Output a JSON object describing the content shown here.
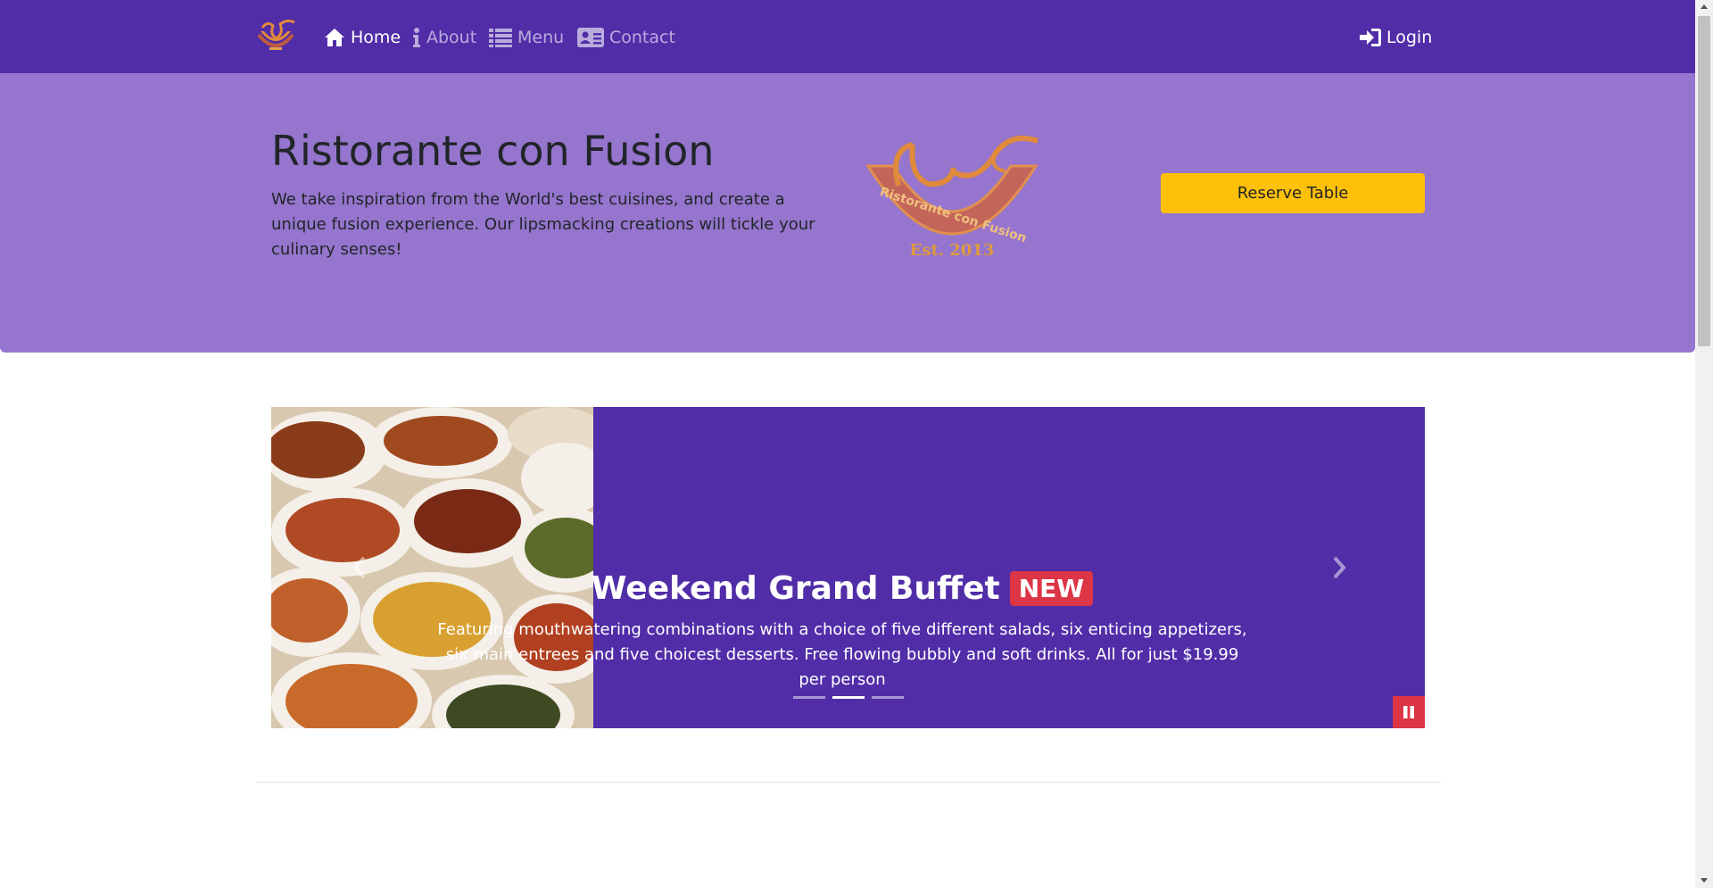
{
  "nav": {
    "home": "Home",
    "about": "About",
    "menu": "Menu",
    "contact": "Contact",
    "login": "Login",
    "icons": {
      "home": "home-icon",
      "about": "info-icon",
      "menu": "list-icon",
      "contact": "address-card-icon",
      "login": "sign-in-icon"
    }
  },
  "jumbotron": {
    "title": "Ristorante con Fusion",
    "text": "We take inspiration from the World's best cuisines, and create a unique fusion experience. Our lipsmacking creations will tickle your culinary senses!",
    "reserve_label": "Reserve Table",
    "logo_text": "Ristorante con Fusion",
    "logo_est": "Est. 2013"
  },
  "carousel": {
    "title": "Weekend Grand Buffet",
    "badge": "NEW",
    "text": "Featuring mouthwatering combinations with a choice of five different salads, six enticing appetizers, six main entrees and five choicest desserts. Free flowing bubbly and soft drinks. All for just $19.99 per person",
    "active_index": 1,
    "slides": 3
  },
  "colors": {
    "primary": "#512da8",
    "light": "#9575cd",
    "warning": "#ffc107",
    "danger": "#dc3545"
  }
}
